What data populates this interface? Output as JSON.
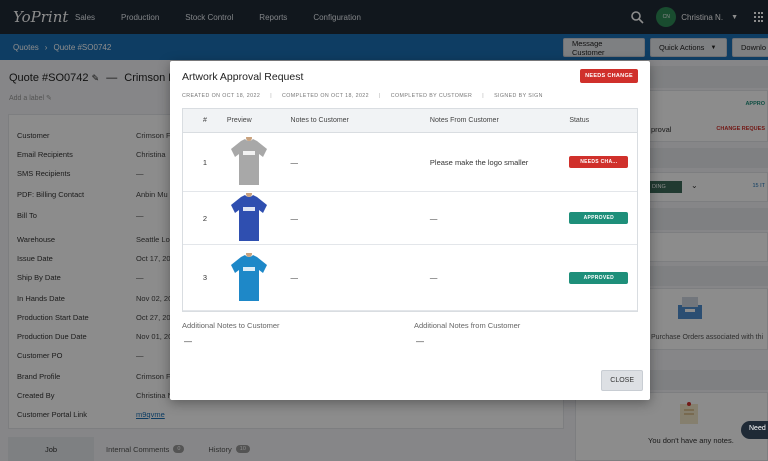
{
  "app": {
    "logo": "YoPrint",
    "nav": [
      "Sales",
      "Production",
      "Stock Control",
      "Reports",
      "Configuration"
    ],
    "user": {
      "initials": "CN",
      "name": "Christina N."
    }
  },
  "breadcrumb": {
    "root": "Quotes",
    "current": "Quote #SO0742"
  },
  "subbar_buttons": {
    "message": "Message Customer",
    "quick": "Quick Actions",
    "download": "Downlo"
  },
  "quote": {
    "title": "Quote #SO0742",
    "title_suffix": "Crimson Flo",
    "add_label": "Add a label",
    "fields": [
      {
        "label": "Customer",
        "value": "Crimson F"
      },
      {
        "label": "Email Recipients",
        "value": "Christina"
      },
      {
        "label": "SMS Recipients",
        "value": "—"
      },
      {
        "label": "PDF: Billing Contact",
        "value": "Anbin Mu"
      },
      {
        "label": "Bill To",
        "value": "—"
      },
      {
        "label": "Warehouse",
        "value": "Seattle Lo"
      },
      {
        "label": "Issue Date",
        "value": "Oct 17, 20"
      },
      {
        "label": "Ship By Date",
        "value": "—"
      },
      {
        "label": "In Hands Date",
        "value": "Nov 02, 20"
      },
      {
        "label": "Production Start Date",
        "value": "Oct 27, 20"
      },
      {
        "label": "Production Due Date",
        "value": "Nov 01, 20"
      },
      {
        "label": "Customer PO",
        "value": "—"
      },
      {
        "label": "Brand Profile",
        "value": "Crimson F"
      },
      {
        "label": "Created By",
        "value": "Christina N"
      },
      {
        "label": "Customer Portal Link",
        "value": "m9qvme"
      }
    ],
    "tabs": [
      {
        "label": "Job"
      },
      {
        "label": "Internal Comments",
        "count": "0"
      },
      {
        "label": "History",
        "count": "10"
      }
    ]
  },
  "right": {
    "approved": "APPRO",
    "approval_label": "proval",
    "change_request": "CHANGE REQUES",
    "pending": "DING",
    "count": "15 IT",
    "po_text": "Purchase Orders associated with thi",
    "notes_text": "You don't have any notes.",
    "need_help": "Need"
  },
  "modal": {
    "title": "Artwork Approval Request",
    "badge": "NEEDS CHANGE",
    "meta": {
      "created": "CREATED ON OCT 18, 2022",
      "completed": "COMPLETED ON OCT 18, 2022",
      "completed_by": "COMPLETED BY CUSTOMER",
      "signed_by": "SIGNED BY SIGN"
    },
    "columns": [
      "#",
      "Preview",
      "Notes to Customer",
      "Notes From Customer",
      "Status"
    ],
    "rows": [
      {
        "num": "1",
        "notes_to": "—",
        "notes_from": "Please make the logo smaller",
        "status": "NEEDS CHA...",
        "color": "#d0302b",
        "shirt": "#a8a8a8"
      },
      {
        "num": "2",
        "notes_to": "—",
        "notes_from": "—",
        "status": "APPROVED",
        "color": "#1e8f7a",
        "shirt": "#2f4fb0"
      },
      {
        "num": "3",
        "notes_to": "—",
        "notes_from": "—",
        "status": "APPROVED",
        "color": "#1e8f7a",
        "shirt": "#1e88c8"
      }
    ],
    "additional_to_label": "Additional Notes to Customer",
    "additional_to_value": "—",
    "additional_from_label": "Additional Notes from Customer",
    "additional_from_value": "—",
    "close": "CLOSE"
  }
}
